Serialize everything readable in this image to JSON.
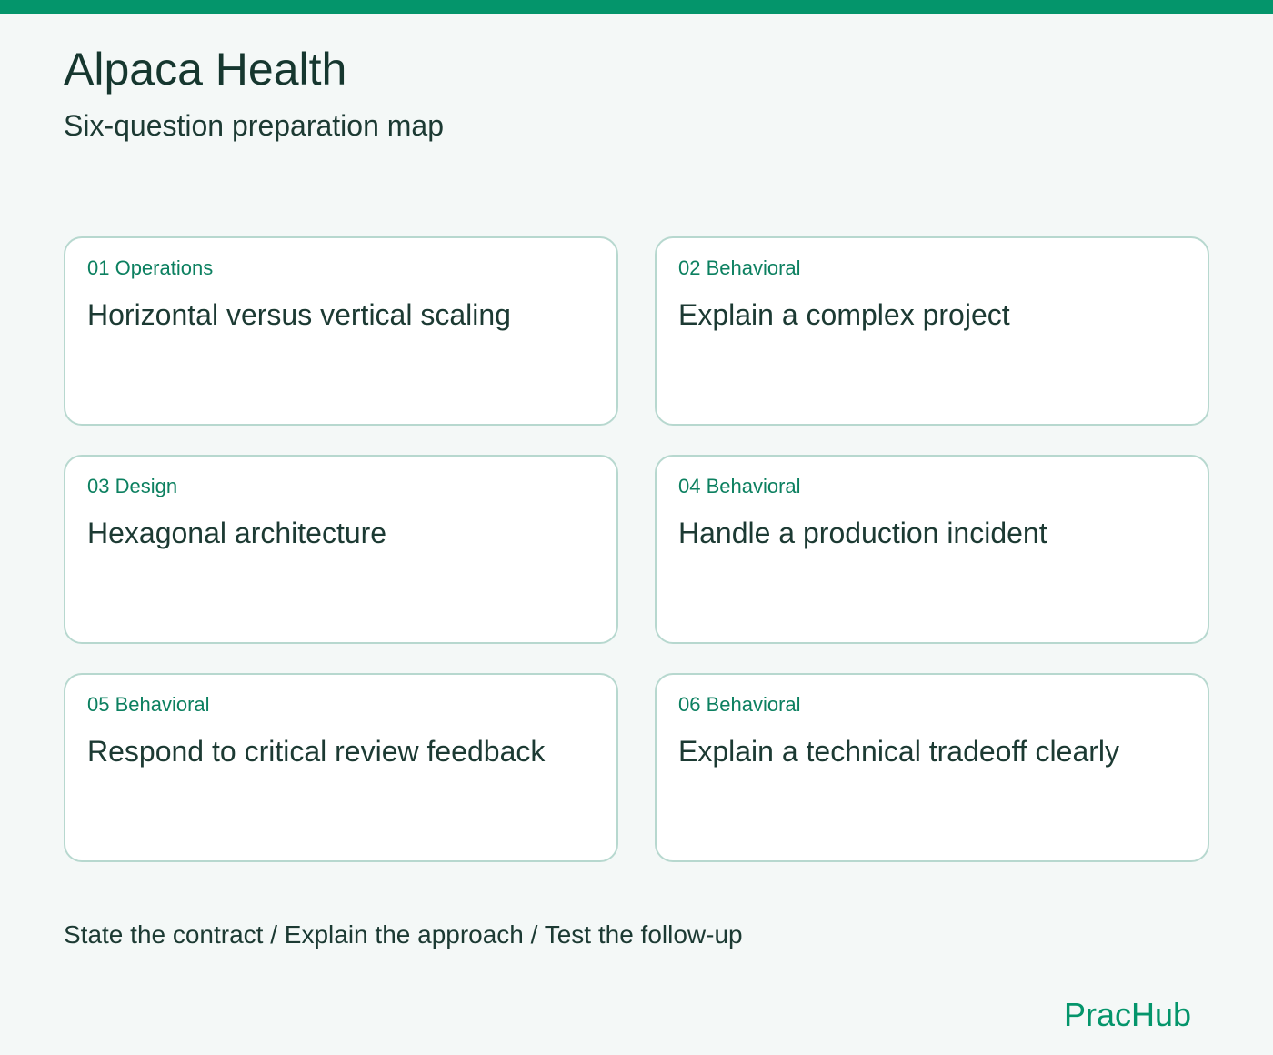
{
  "header": {
    "title": "Alpaca Health",
    "subtitle": "Six-question preparation map"
  },
  "cards": [
    {
      "tag": "01 Operations",
      "title": "Horizontal versus vertical scaling"
    },
    {
      "tag": "02 Behavioral",
      "title": "Explain a complex project"
    },
    {
      "tag": "03 Design",
      "title": "Hexagonal architecture"
    },
    {
      "tag": "04 Behavioral",
      "title": "Handle a production incident"
    },
    {
      "tag": "05 Behavioral",
      "title": "Respond to critical review feedback"
    },
    {
      "tag": "06 Behavioral",
      "title": "Explain a technical tradeoff clearly"
    }
  ],
  "footer": {
    "steps": "State the contract / Explain the approach / Test the follow-up",
    "brand": "PracHub"
  },
  "colors": {
    "accent": "#04956b",
    "background": "#f4f8f7",
    "card_border": "#b7d8cf",
    "text": "#1c3a33"
  }
}
